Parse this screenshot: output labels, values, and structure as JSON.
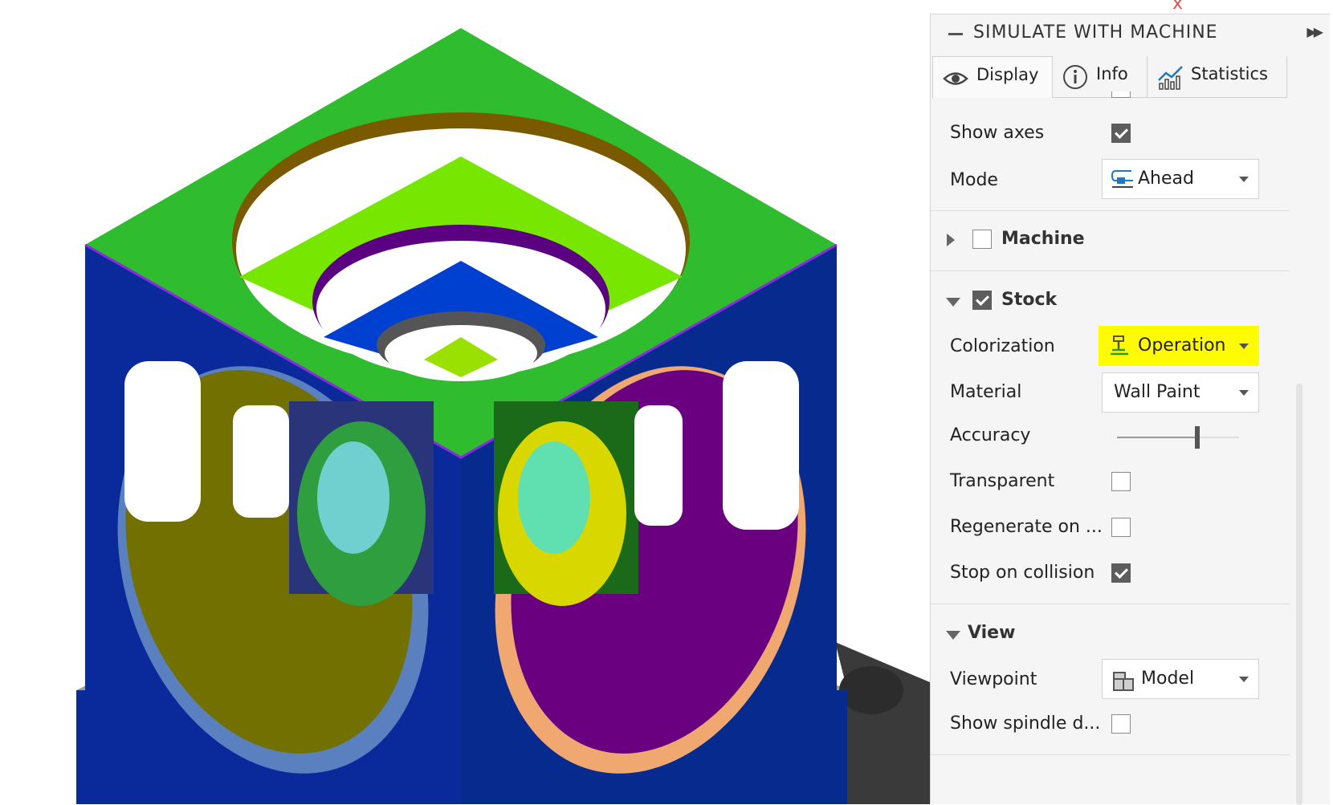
{
  "panel": {
    "title": "SIMULATE WITH MACHINE",
    "tabs": [
      {
        "label": "Display",
        "icon": "eye-icon",
        "active": true
      },
      {
        "label": "Info",
        "icon": "info-icon",
        "active": false
      },
      {
        "label": "Statistics",
        "icon": "statistics-icon",
        "active": false
      }
    ],
    "rows": {
      "show_axes": {
        "label": "Show axes",
        "checked": true
      },
      "mode": {
        "label": "Mode",
        "value": "Ahead",
        "icon": "mode-ahead-icon"
      },
      "machine": {
        "label": "Machine",
        "checked": false,
        "expanded": false
      },
      "stock": {
        "label": "Stock",
        "checked": true,
        "expanded": true
      },
      "colorization": {
        "label": "Colorization",
        "value": "Operation",
        "icon": "operation-tool-icon",
        "highlight": "#fffb00"
      },
      "material": {
        "label": "Material",
        "value": "Wall Paint"
      },
      "accuracy": {
        "label": "Accuracy",
        "level_fraction": 0.66
      },
      "transparent": {
        "label": "Transparent",
        "checked": false
      },
      "regenerate": {
        "label": "Regenerate on ...",
        "checked": false
      },
      "stop_on_collision": {
        "label": "Stop on collision",
        "checked": true
      },
      "view": {
        "label": "View",
        "expanded": true
      },
      "viewpoint": {
        "label": "Viewpoint",
        "value": "Model",
        "icon": "model-cube-icon"
      },
      "show_spindle": {
        "label": "Show spindle d...",
        "checked": false
      }
    }
  },
  "colors": {
    "top_face": "#2fbc2f",
    "left_face": "#0a2a9c",
    "right_face": "#062a8e",
    "olive": "#727000",
    "purple": "#6a0080",
    "fixture": "#a39e90"
  }
}
